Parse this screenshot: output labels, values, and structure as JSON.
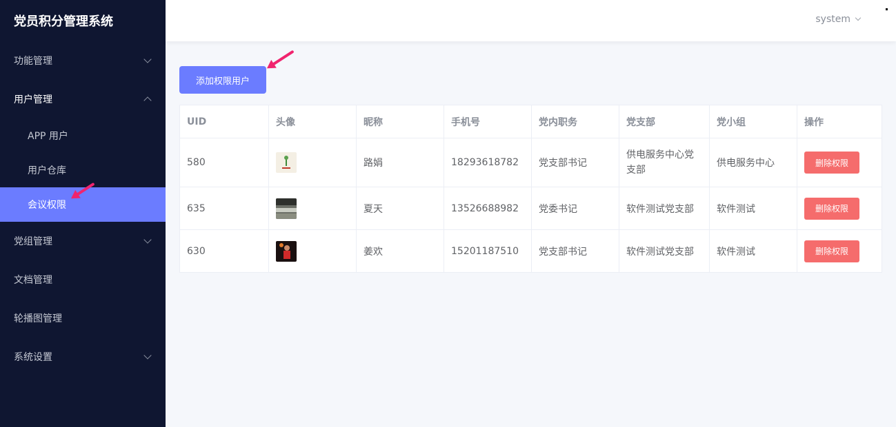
{
  "app": {
    "title": "党员积分管理系统"
  },
  "sidebar": {
    "items": [
      {
        "label": "功能管理"
      },
      {
        "label": "用户管理"
      },
      {
        "label": "党组管理"
      },
      {
        "label": "文档管理"
      },
      {
        "label": "轮播图管理"
      },
      {
        "label": "系统设置"
      }
    ],
    "subitems": [
      {
        "label": "APP 用户"
      },
      {
        "label": "用户仓库"
      },
      {
        "label": "会议权限"
      }
    ]
  },
  "header": {
    "user": "system"
  },
  "toolbar": {
    "add_label": "添加权限用户"
  },
  "table": {
    "headers": [
      "UID",
      "头像",
      "昵称",
      "手机号",
      "党内职务",
      "党支部",
      "党小组",
      "操作"
    ],
    "rows": [
      {
        "uid": "580",
        "nickname": "路娟",
        "phone": "18293618782",
        "position": "党支部书记",
        "branch": "供电服务中心党支部",
        "group": "供电服务中心",
        "action": "删除权限"
      },
      {
        "uid": "635",
        "nickname": "夏天",
        "phone": "13526688982",
        "position": "党委书记",
        "branch": "软件测试党支部",
        "group": "软件测试",
        "action": "删除权限"
      },
      {
        "uid": "630",
        "nickname": "姜欢",
        "phone": "15201187510",
        "position": "党支部书记",
        "branch": "软件测试党支部",
        "group": "软件测试",
        "action": "删除权限"
      }
    ]
  },
  "colors": {
    "sidebar_bg": "#0f1631",
    "accent": "#6b7cff",
    "danger": "#f56c6c",
    "arrow": "#f0246e"
  }
}
